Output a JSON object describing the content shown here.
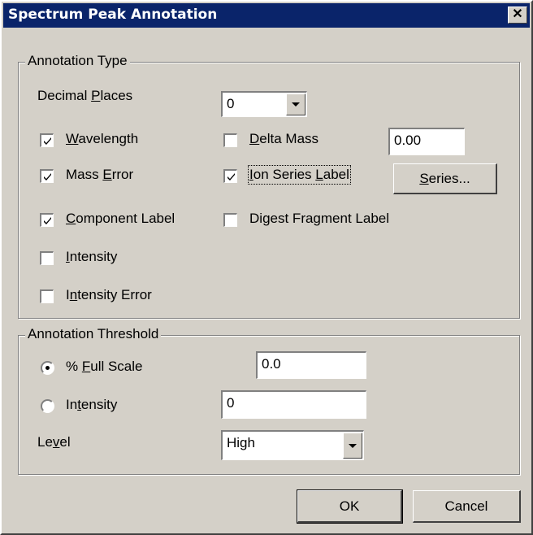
{
  "window": {
    "title": "Spectrum Peak Annotation"
  },
  "annotation_type": {
    "legend": "Annotation Type",
    "decimal_places": {
      "label": "Decimal Places",
      "value": "0"
    },
    "wavelength": {
      "label": "Wavelength",
      "checked": true
    },
    "delta_mass": {
      "label": "Delta Mass",
      "checked": false,
      "value": "0.00"
    },
    "mass_error": {
      "label": "Mass Error",
      "checked": true
    },
    "ion_series_label": {
      "label": "Ion Series Label",
      "checked": true
    },
    "series_button": "Series...",
    "component_label": {
      "label": "Component Label",
      "checked": true
    },
    "digest_fragment_label": {
      "label": "Digest Fragment Label",
      "checked": false
    },
    "intensity": {
      "label": "Intensity",
      "checked": false
    },
    "intensity_error": {
      "label": "Intensity Error",
      "checked": false
    }
  },
  "annotation_threshold": {
    "legend": "Annotation Threshold",
    "full_scale": {
      "label": "% Full Scale",
      "selected": true,
      "value": "0.0"
    },
    "intensity": {
      "label": "Intensity",
      "selected": false,
      "value": "0"
    },
    "level": {
      "label": "Level",
      "value": "High"
    }
  },
  "buttons": {
    "ok": "OK",
    "cancel": "Cancel"
  },
  "icons": {
    "close": "close-icon",
    "check": "check-icon",
    "dropdown": "chevron-down-icon"
  }
}
